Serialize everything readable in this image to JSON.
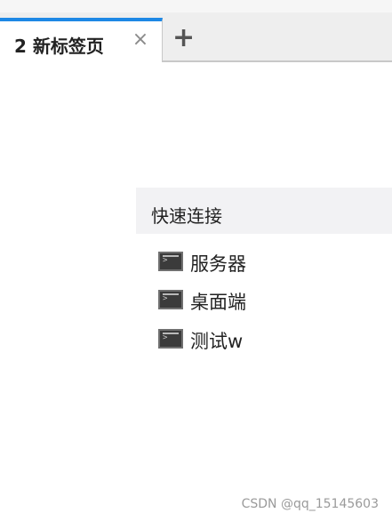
{
  "tabs": [
    {
      "label": "2 新标签页",
      "close_icon": "close-icon"
    }
  ],
  "new_tab_icon": "plus-icon",
  "quick_connect": {
    "title": "快速连接",
    "items": [
      {
        "label": "服务器",
        "icon": "terminal-icon"
      },
      {
        "label": "桌面端",
        "icon": "terminal-icon"
      },
      {
        "label": "测试w",
        "icon": "terminal-icon"
      }
    ]
  },
  "watermark": "CSDN @qq_15145603",
  "colors": {
    "active_tab_accent": "#1e88e5",
    "tab_bar_bg": "#eeeeee",
    "quick_header_bg": "#f2f2f4"
  }
}
